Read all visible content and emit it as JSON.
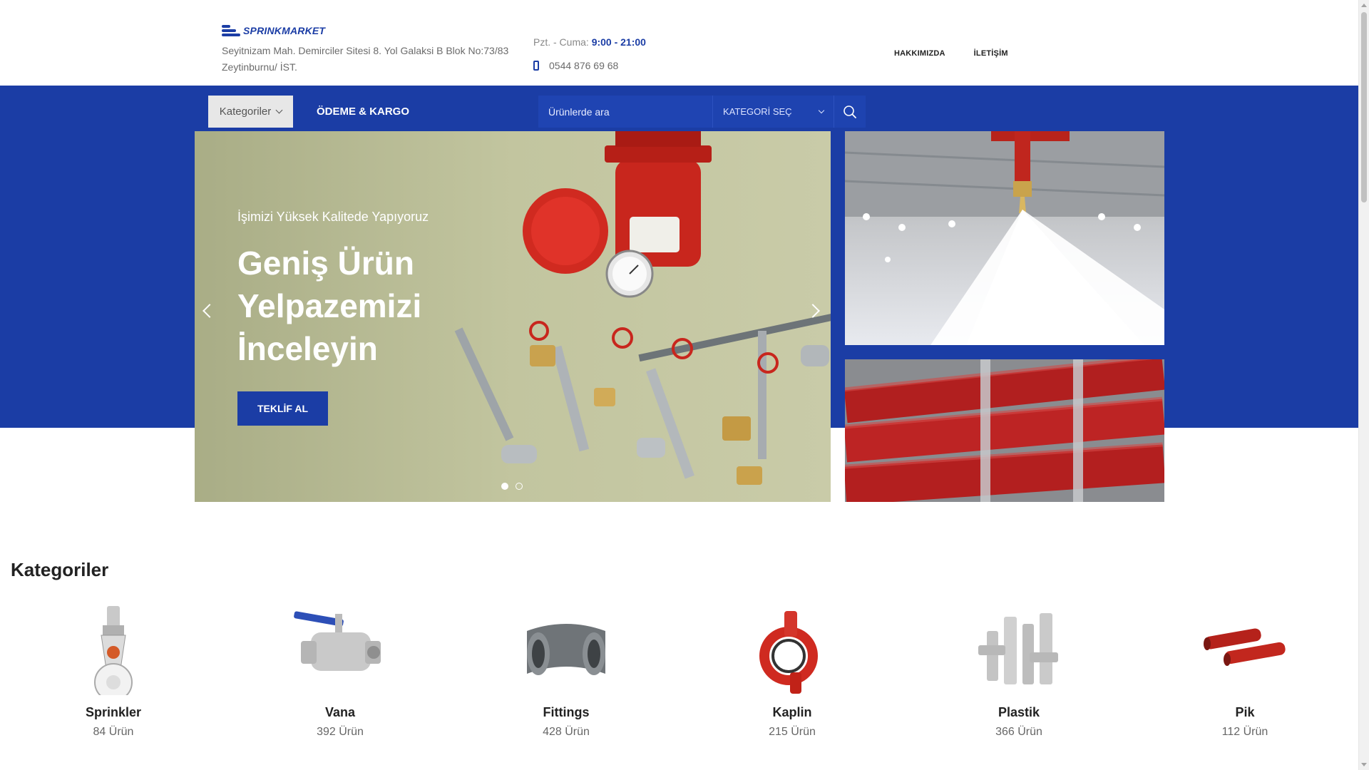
{
  "header": {
    "logo_text": "SPRINKMARKET",
    "address": "Seyitnizam Mah. Demirciler Sitesi 8. Yol Galaksi B Blok No:73/83 Zeytinburnu/ İST.",
    "hours_label": "Pzt. - Cuma:",
    "hours_value": "9:00 - 21:00",
    "phone": "0544 876 69 68",
    "links": [
      "HAKKIMIZDA",
      "İLETİŞİM"
    ]
  },
  "nav": {
    "categories_button": "Kategoriler",
    "payment_link": "ÖDEME & KARGO",
    "search_placeholder": "Ürünlerde ara",
    "category_select": "KATEGORİ SEÇ"
  },
  "slider": {
    "subtitle": "İşimizi Yüksek Kalitede Yapıyoruz",
    "title": "Geniş Ürün Yelpazemizi İnceleyin",
    "button": "TEKLİF AL",
    "active_slide": 1,
    "total_slides": 2
  },
  "categories": {
    "title": "Kategoriler",
    "items": [
      {
        "name": "Sprinkler",
        "count": "84 Ürün"
      },
      {
        "name": "Vana",
        "count": "392 Ürün"
      },
      {
        "name": "Fittings",
        "count": "428 Ürün"
      },
      {
        "name": "Kaplin",
        "count": "215 Ürün"
      },
      {
        "name": "Plastik",
        "count": "366 Ürün"
      },
      {
        "name": "Pik",
        "count": "112 Ürün"
      }
    ]
  },
  "colors": {
    "brand_blue": "#1b3da5",
    "pipe_red": "#c62828"
  }
}
